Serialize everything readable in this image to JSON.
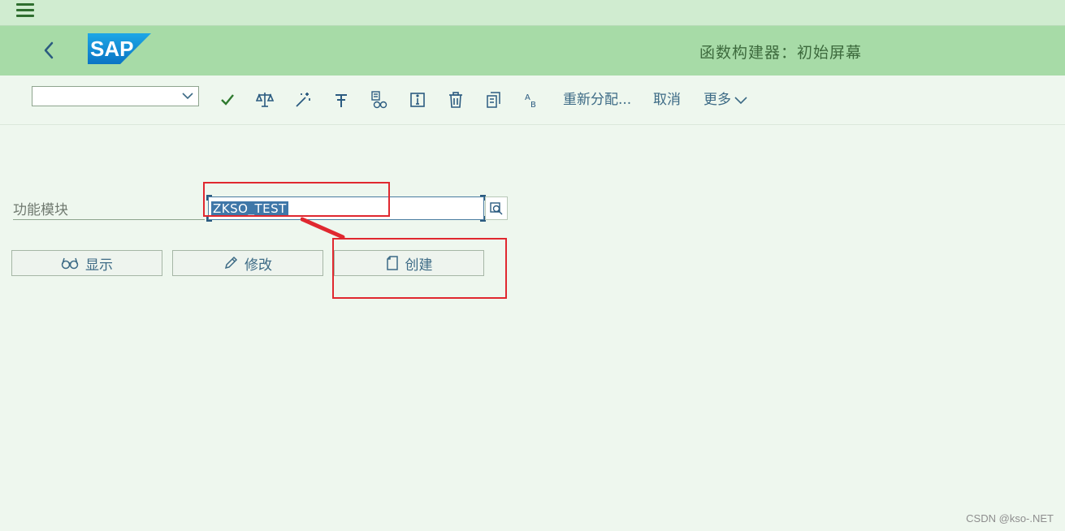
{
  "menubar": {
    "menu_icon": "hamburger-menu-icon"
  },
  "header": {
    "back_icon": "chevron-left-icon",
    "logo_text": "SAP",
    "title": "函数构建器：初始屏幕"
  },
  "toolbar": {
    "dropdown_value": "",
    "icons": [
      "check-icon",
      "scales-icon",
      "magic-wand-icon",
      "text-format-icon",
      "where-used-icon",
      "info-icon",
      "delete-icon",
      "copy-icon",
      "rename-icon"
    ],
    "reassign_label": "重新分配...",
    "cancel_label": "取消",
    "more_label": "更多"
  },
  "form": {
    "function_module_label": "功能模块",
    "function_module_value": "ZKSO_TEST"
  },
  "actions": {
    "display_label": "显示",
    "change_label": "修改",
    "create_label": "创建"
  },
  "colors": {
    "header_bg": "#a7dba7",
    "menubar_bg": "#d0ecd0",
    "page_bg": "#eef7ee",
    "accent": "#3c6a85",
    "annotation_red": "#e0282f"
  },
  "watermark": "CSDN @kso-.NET"
}
